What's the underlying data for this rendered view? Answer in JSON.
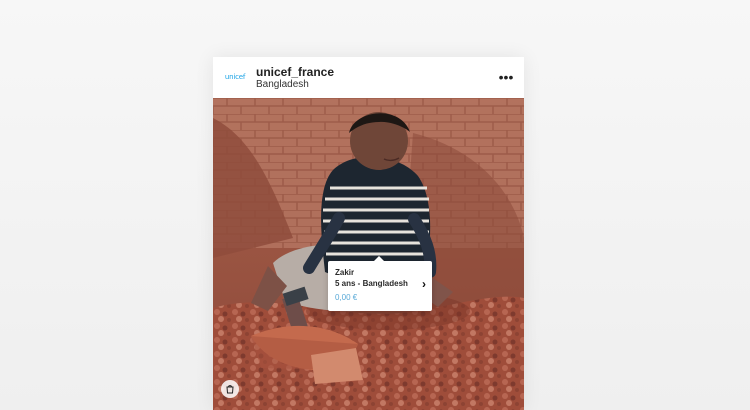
{
  "post": {
    "avatar_text": "unicef",
    "account_name": "unicef_france",
    "location": "Bangladesh",
    "more_icon": "more-icon"
  },
  "tag": {
    "name": "Zakir",
    "subtitle": "5 ans - Bangladesh",
    "price": "0,00 €",
    "chevron_icon": "chevron-right-icon"
  },
  "shopping_icon": "shopping-bag-icon",
  "colors": {
    "brand_blue": "#1ca3e5",
    "price_blue": "#59a9d7"
  }
}
